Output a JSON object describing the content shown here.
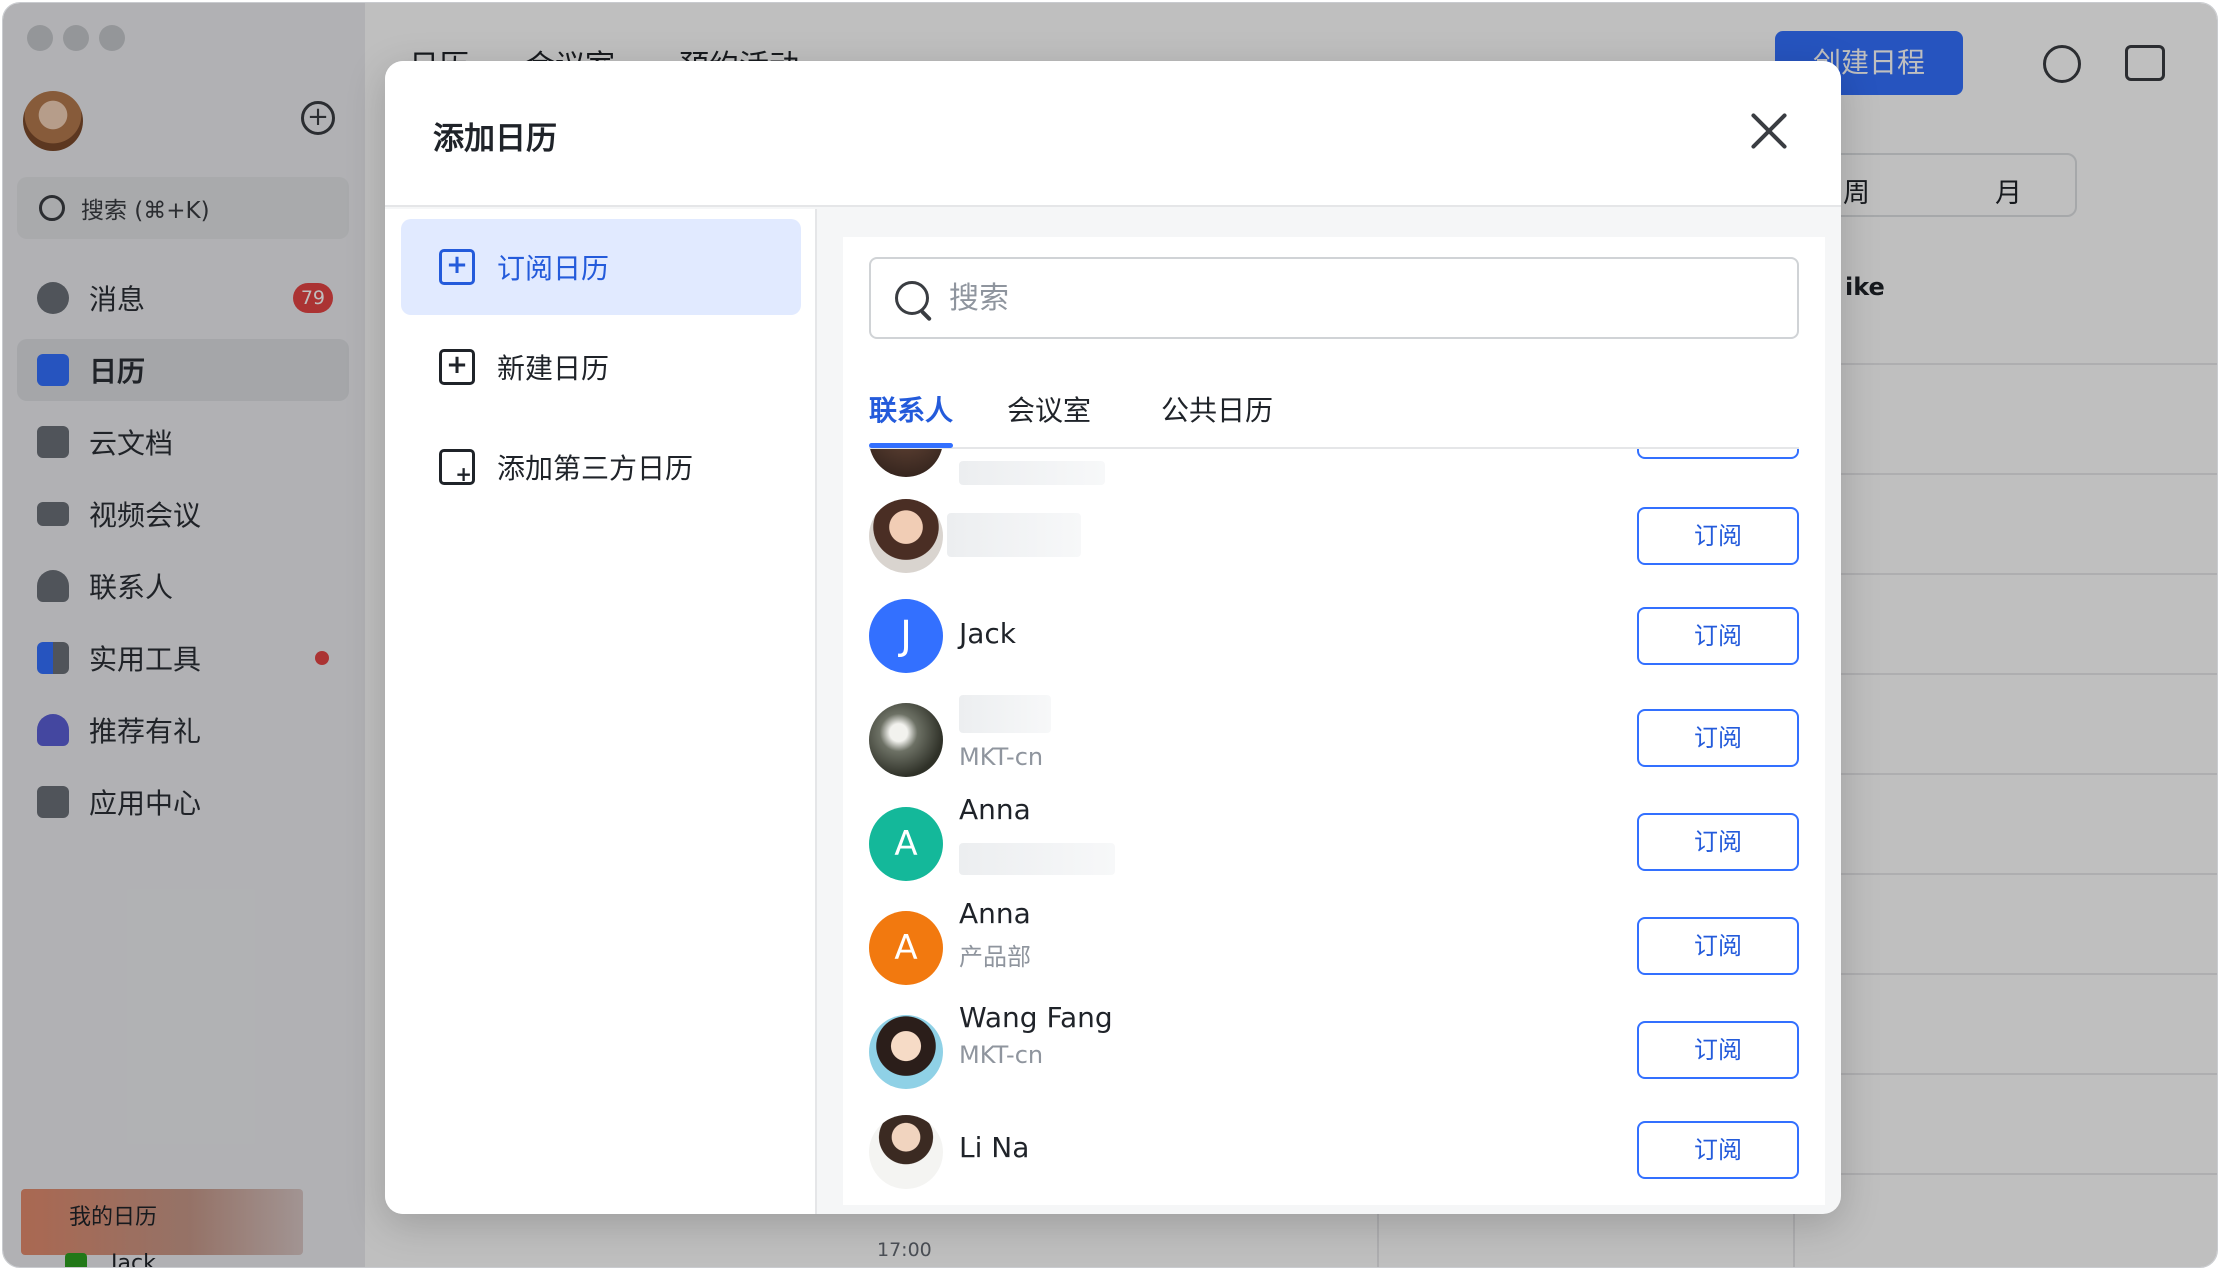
{
  "sidebar": {
    "search": "搜索 (⌘+K)",
    "items": [
      {
        "label": "消息",
        "badge": "79"
      },
      {
        "label": "日历"
      },
      {
        "label": "云文档"
      },
      {
        "label": "视频会议"
      },
      {
        "label": "联系人"
      },
      {
        "label": "实用工具"
      },
      {
        "label": "推荐有礼"
      },
      {
        "label": "应用中心"
      }
    ]
  },
  "main": {
    "tabs": [
      "日历",
      "会议室",
      "预约活动"
    ],
    "create_button": "创建日程",
    "view_options": [
      "周",
      "月"
    ],
    "column_header": "ike",
    "time_label": "17:00",
    "my_calendars": "我的日历",
    "my_calendar_item": "Jack"
  },
  "modal": {
    "title": "添加日历",
    "menu": [
      {
        "label": "订阅日历",
        "active": true
      },
      {
        "label": "新建日历"
      },
      {
        "label": "添加第三方日历"
      }
    ],
    "search_placeholder": "搜索",
    "tabs": [
      {
        "label": "联系人",
        "active": true
      },
      {
        "label": "会议室"
      },
      {
        "label": "公共日历"
      }
    ],
    "subscribe_label": "订阅",
    "contacts": [
      {
        "name": "",
        "dept": "",
        "avatar": "photo-dark"
      },
      {
        "name": "",
        "dept": "",
        "avatar": "photo-woman"
      },
      {
        "name": "Jack",
        "dept": "",
        "avatar": "J",
        "color": "#3370ff"
      },
      {
        "name": "",
        "dept": "MKT-cn",
        "avatar": "photo-landscape"
      },
      {
        "name": "Anna",
        "dept": "",
        "avatar": "A",
        "color": "#14b89a"
      },
      {
        "name": "Anna",
        "dept": "产品部",
        "avatar": "A",
        "color": "#f2790f"
      },
      {
        "name": "Wang Fang",
        "dept": "MKT-cn",
        "avatar": "photo-woman-2"
      },
      {
        "name": "Li Na",
        "dept": "",
        "avatar": "photo-woman-3"
      }
    ]
  },
  "colors": {
    "accent": "#3370ff",
    "accent_text": "#245bdb",
    "active_menu_bg": "#e1eaff",
    "badge": "#e54545"
  }
}
